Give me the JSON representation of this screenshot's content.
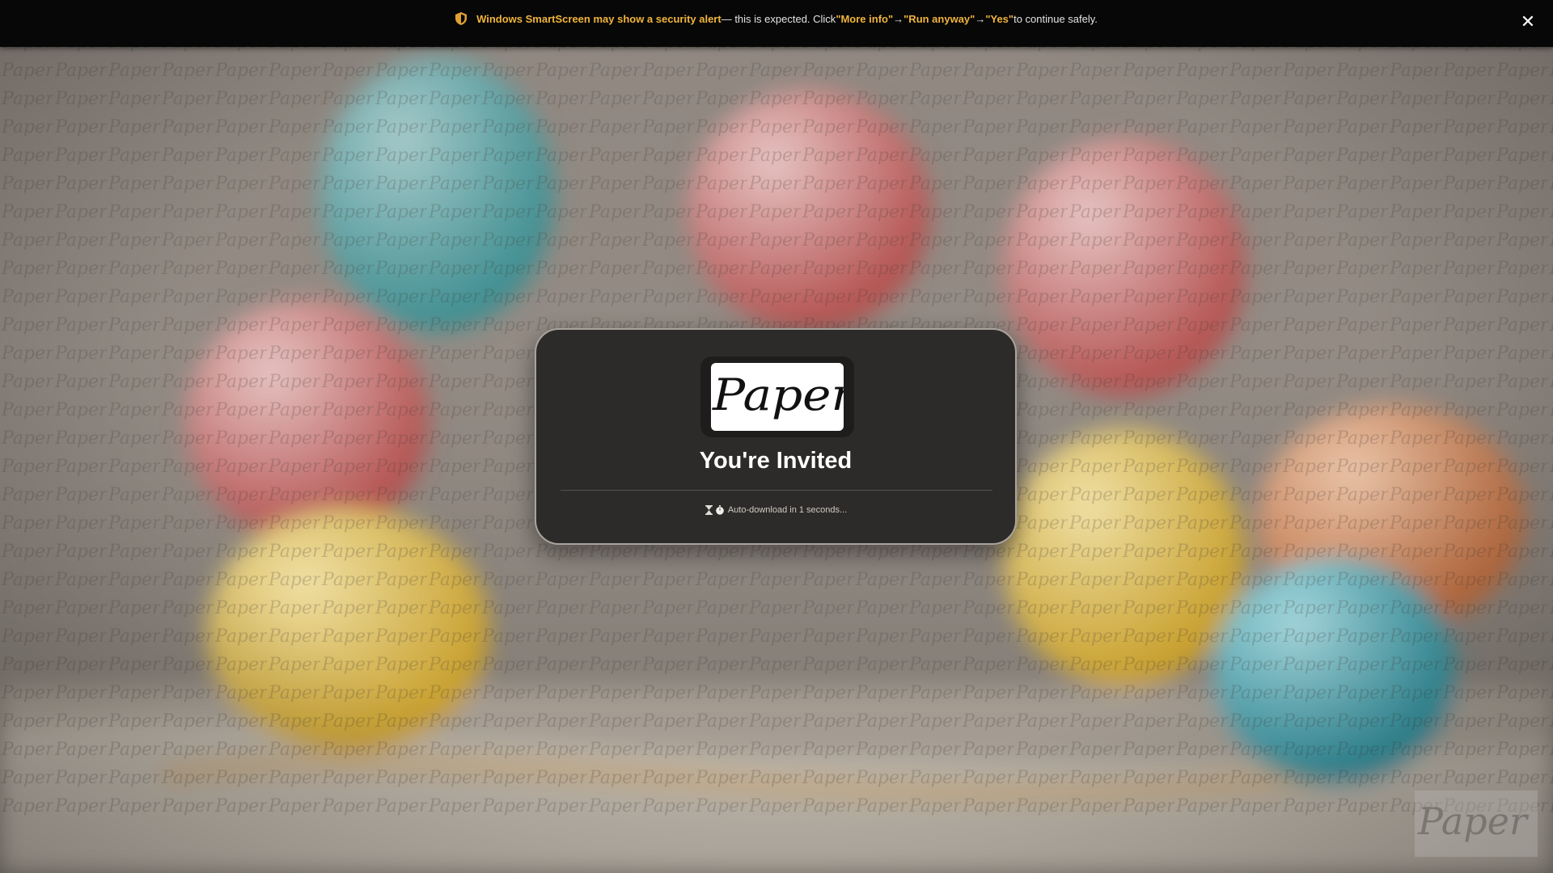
{
  "banner": {
    "alert_title": "Windows SmartScreen may show a security alert",
    "text_1": " — this is expected. Click ",
    "step_1": "\"More info\"",
    "arrow_1": " → ",
    "step_2": "\"Run anyway\"",
    "arrow_2": " → ",
    "step_3": "\"Yes\"",
    "text_2": " to continue safely.",
    "close_glyph": "✕",
    "icon": "shield-icon",
    "accent_color": "#f0b43c"
  },
  "card": {
    "logo_text": "Paper",
    "title": "You're Invited",
    "countdown_text": "Auto-download in 1 seconds...",
    "countdown_icons": [
      "hourglass-icon",
      "timer-icon"
    ]
  },
  "background": {
    "pattern_word": "Paper",
    "watermark_text": "Paper"
  }
}
